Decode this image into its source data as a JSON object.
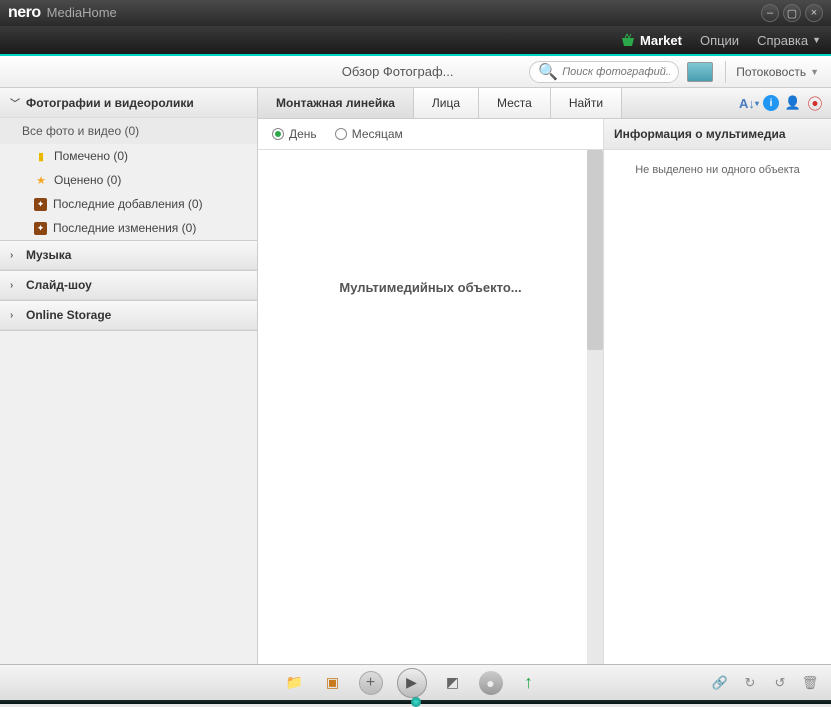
{
  "app": {
    "brand": "nero",
    "product": "MediaHome"
  },
  "menubar": {
    "market": "Market",
    "options": "Опции",
    "help": "Справка"
  },
  "toolbar": {
    "title": "Обзор Фотограф...",
    "search_placeholder": "Поиск фотографий...",
    "stream": "Потоковость"
  },
  "sidebar": {
    "sections": [
      {
        "label": "Фотографии и видеоролики",
        "expanded": true,
        "sub": "Все фото и видео (0)",
        "items": [
          {
            "icon": "bookmark",
            "label": "Помечено (0)"
          },
          {
            "icon": "star",
            "label": "Оценено (0)"
          },
          {
            "icon": "box",
            "label": "Последние добавления (0)"
          },
          {
            "icon": "box",
            "label": "Последние изменения (0)"
          }
        ]
      },
      {
        "label": "Музыка",
        "expanded": false
      },
      {
        "label": "Слайд-шоу",
        "expanded": false
      },
      {
        "label": "Online Storage",
        "expanded": false
      }
    ]
  },
  "tabs": {
    "items": [
      "Монтажная линейка",
      "Лица",
      "Места",
      "Найти"
    ],
    "active": 0
  },
  "filter": {
    "day": "День",
    "month": "Месяцам",
    "selected": "day"
  },
  "viewer": {
    "empty": "Мультимедийных объекто..."
  },
  "infopanel": {
    "title": "Информация о мультимедиа",
    "empty": "Не выделено ни одного объекта"
  }
}
